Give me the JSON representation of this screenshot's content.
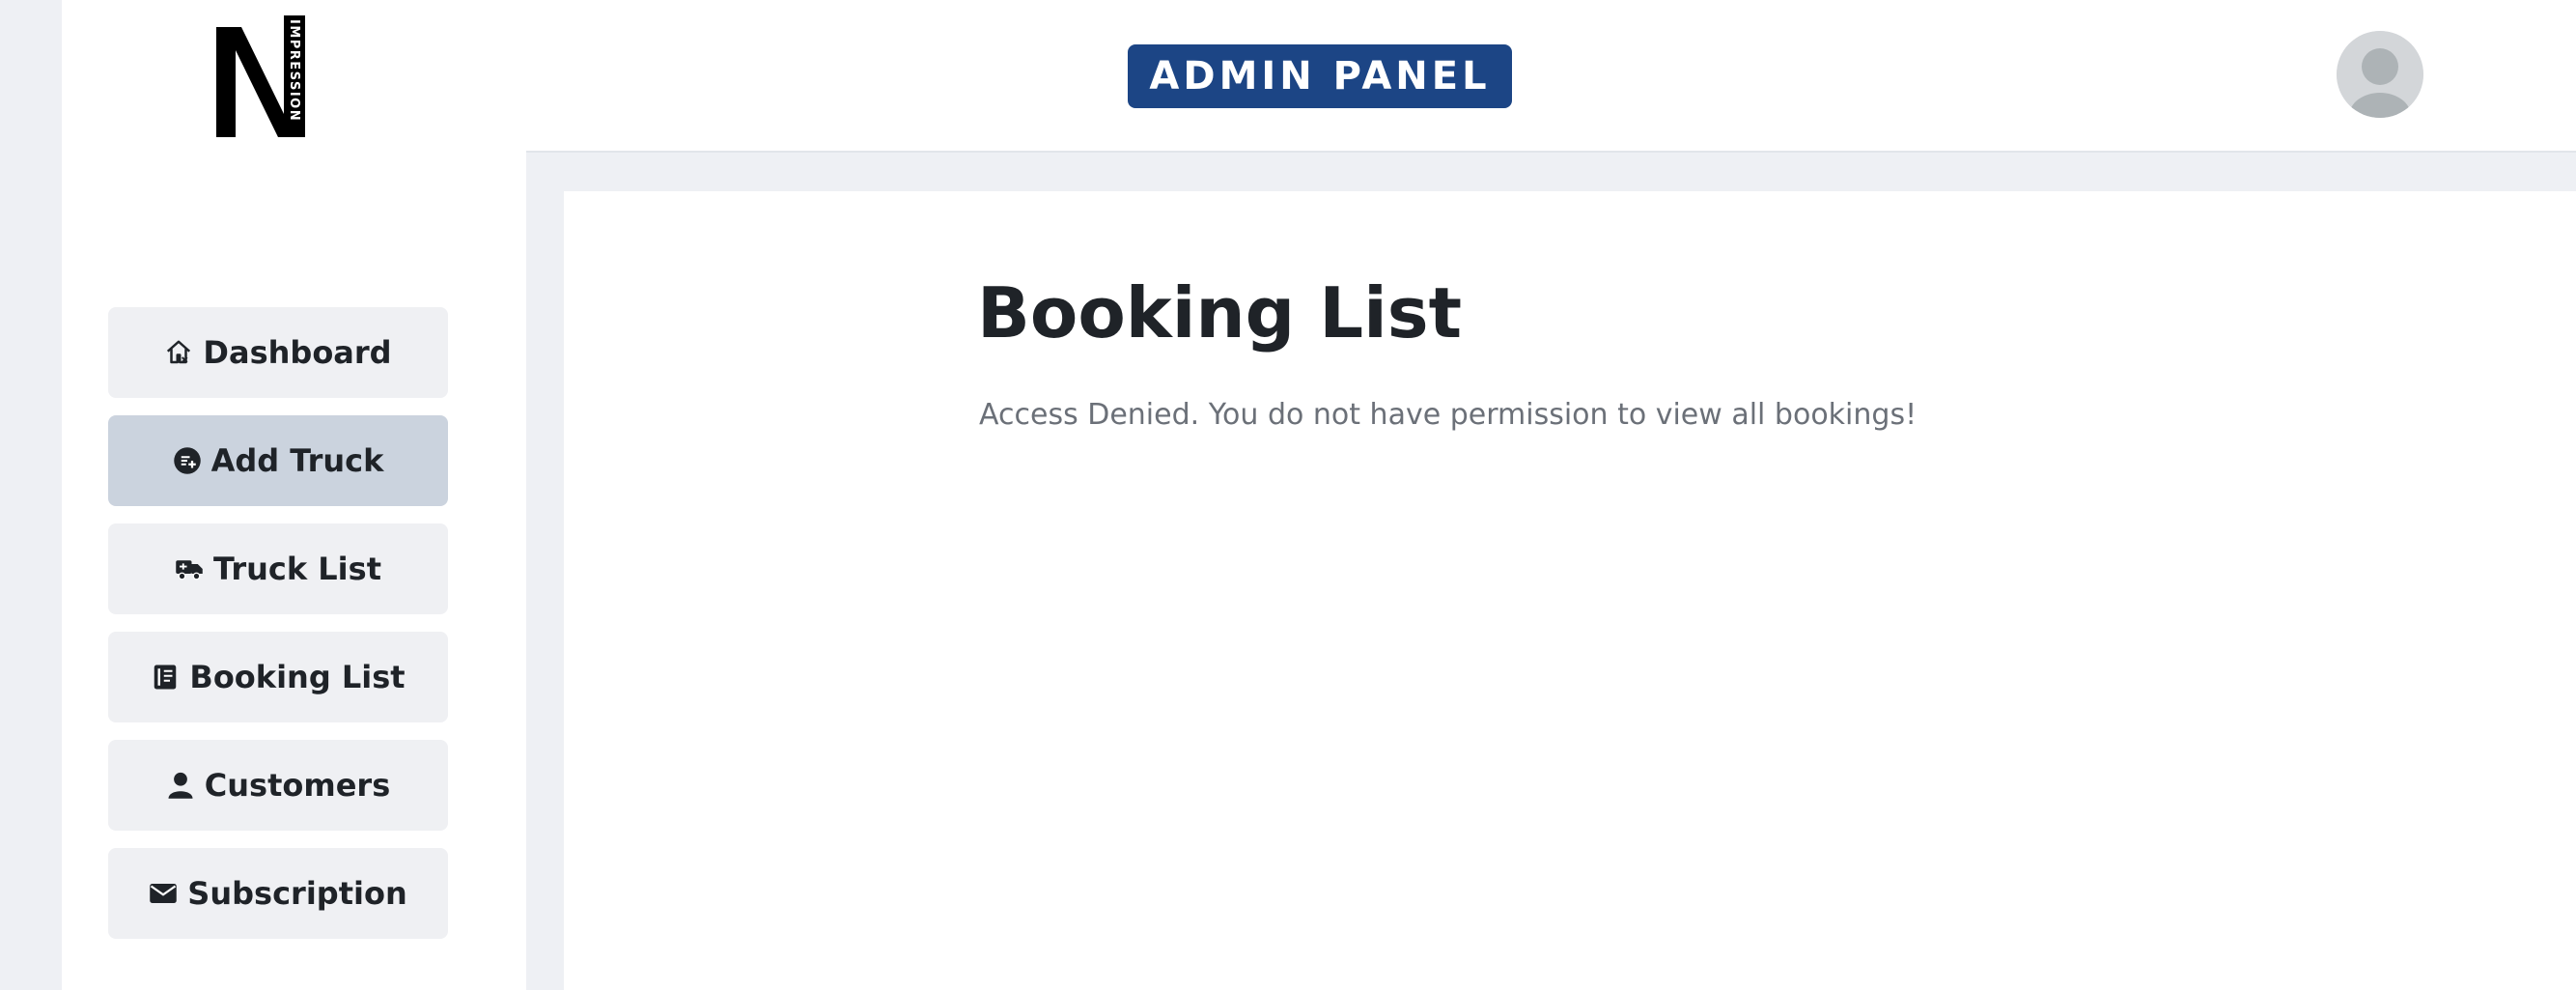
{
  "header": {
    "badge_label": "ADMIN PANEL",
    "badge_color": "#1c4585"
  },
  "logo": {
    "letter": "N",
    "wordmark": "IMPRESSION"
  },
  "sidebar": {
    "items": [
      {
        "label": "Dashboard",
        "icon": "home-icon",
        "active": false
      },
      {
        "label": "Add Truck",
        "icon": "add-circle-icon",
        "active": true
      },
      {
        "label": "Truck List",
        "icon": "truck-icon",
        "active": false
      },
      {
        "label": "Booking List",
        "icon": "book-icon",
        "active": false
      },
      {
        "label": "Customers",
        "icon": "user-icon",
        "active": false
      },
      {
        "label": "Subscription",
        "icon": "mail-icon",
        "active": false
      }
    ]
  },
  "main": {
    "title": "Booking List",
    "message": "Access Denied. You do not have permission to view all bookings!"
  },
  "colors": {
    "active_nav": "#cbd3de",
    "nav": "#eff0f3",
    "background": "#eef0f4"
  }
}
